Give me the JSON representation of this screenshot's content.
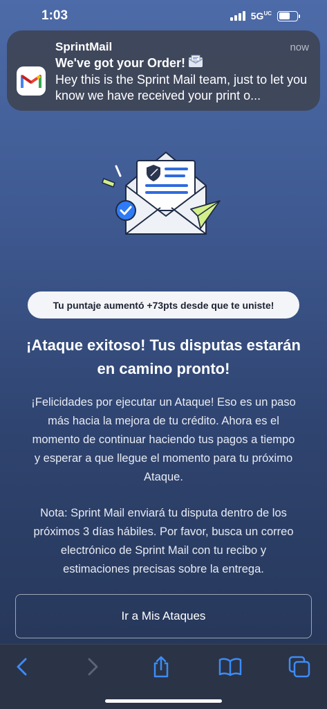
{
  "status_bar": {
    "time": "1:03",
    "network": "5G",
    "network_suffix": "UC"
  },
  "notification": {
    "app_name": "SprintMail",
    "time": "now",
    "title": "We've got your Order!",
    "text": "Hey this is the Sprint Mail team, just to let you know we have received your print o...",
    "app_icon": "gmail-m-icon",
    "title_emoji_icon": "envelope-icon"
  },
  "main": {
    "illustration_icon": "mail-envelope-illustration",
    "score_pill": "Tu puntaje aumentó +73pts desde que te uniste!",
    "headline_line1": "¡Ataque exitoso! Tus disputas estarán",
    "headline_line2": "en camino pronto!",
    "paragraph1_lines": [
      "¡Felicidades por ejecutar un Ataque! Eso es un paso",
      "más hacia la mejora de tu crédito. Ahora es el",
      "momento de continuar haciendo tus pagos a tiempo",
      "y esperar a que llegue el momento para tu próximo",
      "Ataque."
    ],
    "paragraph2_lines": [
      "Nota: Sprint Mail enviará tu disputa dentro de los",
      "próximos 3 días hábiles. Por favor, busca un correo",
      "electrónico de Sprint Mail con tu recibo y",
      "estimaciones precisas sobre la entrega."
    ],
    "cta_label": "Ir a Mis Ataques"
  },
  "toolbar": {
    "back_icon": "chevron-left-icon",
    "forward_icon": "chevron-right-icon",
    "share_icon": "share-icon",
    "bookmarks_icon": "book-icon",
    "tabs_icon": "tabs-icon"
  },
  "colors": {
    "background_top": "#4d6ba8",
    "background_bottom": "#243454",
    "accent_blue": "#2f7bf6",
    "accent_green": "#d3ef8a",
    "toolbar": "#2b3346"
  }
}
